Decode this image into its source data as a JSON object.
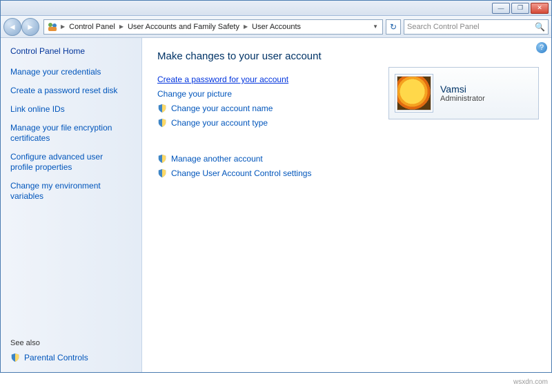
{
  "titlebar": {
    "min": "—",
    "max": "❐",
    "close": "✕"
  },
  "breadcrumb": {
    "seg1": "Control Panel",
    "seg2": "User Accounts and Family Safety",
    "seg3": "User Accounts"
  },
  "search": {
    "placeholder": "Search Control Panel"
  },
  "sidebar": {
    "home": "Control Panel Home",
    "links": {
      "l0": "Manage your credentials",
      "l1": "Create a password reset disk",
      "l2": "Link online IDs",
      "l3": "Manage your file encryption certificates",
      "l4": "Configure advanced user profile properties",
      "l5": "Change my environment variables"
    },
    "see_also": "See also",
    "parental": "Parental Controls"
  },
  "content": {
    "heading": "Make changes to your user account",
    "actions": {
      "a0": "Create a password for your account",
      "a1": "Change your picture",
      "a2": "Change your account name",
      "a3": "Change your account type",
      "a4": "Manage another account",
      "a5": "Change User Account Control settings"
    }
  },
  "user": {
    "name": "Vamsi",
    "role": "Administrator"
  },
  "watermark": "wsxdn.com"
}
